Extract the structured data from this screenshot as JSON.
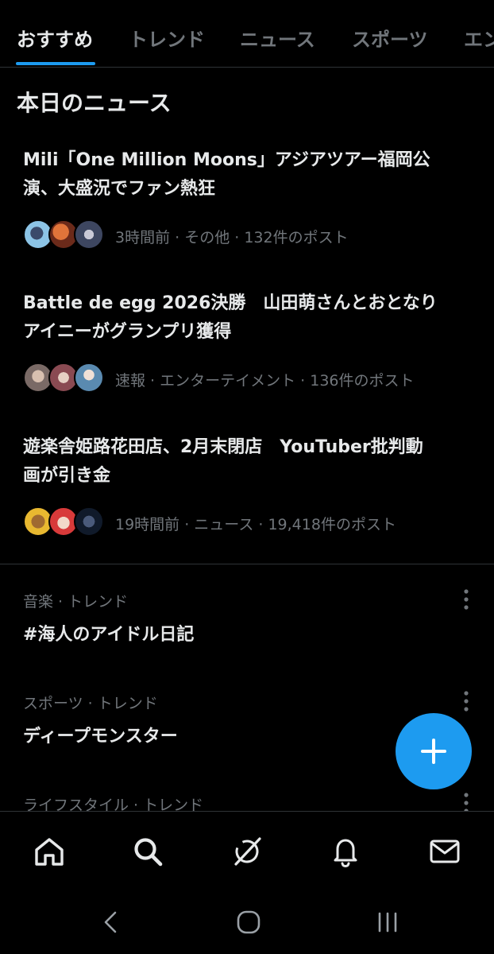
{
  "tabs": {
    "items": [
      {
        "label": "おすすめ",
        "active": true
      },
      {
        "label": "トレンド",
        "active": false
      },
      {
        "label": "ニュース",
        "active": false
      },
      {
        "label": "スポーツ",
        "active": false
      },
      {
        "label": "エンタメ",
        "active": false
      }
    ]
  },
  "section": {
    "title": "本日のニュース"
  },
  "news": [
    {
      "headline": "Mili「One Million Moons」アジアツアー福岡公\n演、大盛況でファン熱狂",
      "meta": "3時間前 · その他 · 132件のポスト"
    },
    {
      "headline": "Battle de egg 2026決勝　山田萌さんとおとなり\nアイニーがグランプリ獲得",
      "meta": "速報 · エンターテイメント · 136件のポスト"
    },
    {
      "headline": "遊楽舎姫路花田店、2月末閉店　YouTuber批判動\n画が引き金",
      "meta": "19時間前 · ニュース · 19,418件のポスト"
    }
  ],
  "trends": [
    {
      "context": "音楽 · トレンド",
      "title": "#海人のアイドル日記"
    },
    {
      "context": "スポーツ · トレンド",
      "title": "ディープモンスター"
    },
    {
      "context": "ライフスタイル · トレンド",
      "title": ""
    }
  ],
  "icons": {
    "compose": "plus-icon",
    "nav": [
      "home-icon",
      "search-icon",
      "grok-icon",
      "bell-icon",
      "mail-icon"
    ],
    "system": [
      "back-icon",
      "home-circle-icon",
      "recents-icon"
    ]
  },
  "colors": {
    "accent": "#1d9bf0",
    "background": "#000000",
    "primary_text": "#e7e9ea",
    "secondary_text": "#71767b",
    "divider": "#2f3336"
  }
}
